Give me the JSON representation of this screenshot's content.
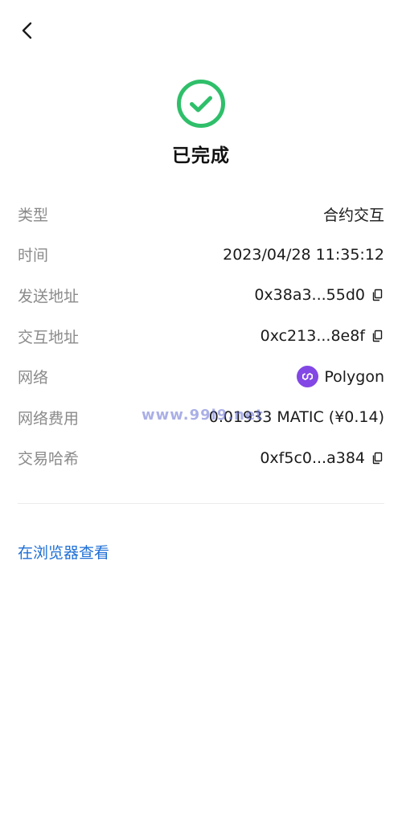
{
  "header": {
    "back_icon": "chevron-left-icon"
  },
  "status": {
    "icon": "check-circle-icon",
    "color": "#2fbf6a",
    "title": "已完成"
  },
  "details": [
    {
      "label": "类型",
      "value": "合约交互"
    },
    {
      "label": "时间",
      "value": "2023/04/28 11:35:12"
    },
    {
      "label": "发送地址",
      "value": "0x38a3...55d0",
      "copyable": true
    },
    {
      "label": "交互地址",
      "value": "0xc213...8e8f",
      "copyable": true
    },
    {
      "label": "网络",
      "value": "Polygon",
      "icon": "polygon-logo-icon",
      "icon_color": "#8247e5"
    },
    {
      "label": "网络费用",
      "value": "0.01933 MATIC (¥0.14)"
    },
    {
      "label": "交易哈希",
      "value": "0xf5c0...a384",
      "copyable": true
    }
  ],
  "explorer_link": {
    "label": "在浏览器查看",
    "color": "#1f6fd6"
  },
  "watermark": "www.99l9.net"
}
